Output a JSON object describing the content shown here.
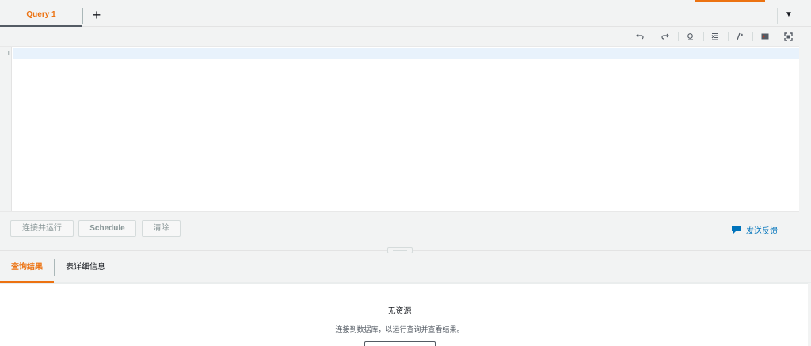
{
  "tabs": [
    {
      "label": "Query 1",
      "active": true
    }
  ],
  "tab_add_label": "+",
  "tab_menu_label": "▼",
  "toolbar": {
    "icons": [
      "undo-icon",
      "redo-icon",
      "find-icon",
      "indent-icon",
      "comment-icon",
      "terminal-icon",
      "fullscreen-icon"
    ]
  },
  "editor": {
    "line_numbers": [
      "1"
    ],
    "content": ""
  },
  "actions": {
    "run_label": "连接并运行",
    "schedule_label": "Schedule",
    "clear_label": "清除",
    "feedback_label": "发送反馈"
  },
  "result_tabs": [
    {
      "label": "查询结果",
      "active": true
    },
    {
      "label": "表详细信息",
      "active": false
    }
  ],
  "results": {
    "empty_title": "无资源",
    "empty_description": "连接到数据库，以运行查询并查看结果。"
  },
  "colors": {
    "accent": "#ec7211",
    "link": "#0073bb",
    "active_line": "#e8f2fc"
  }
}
